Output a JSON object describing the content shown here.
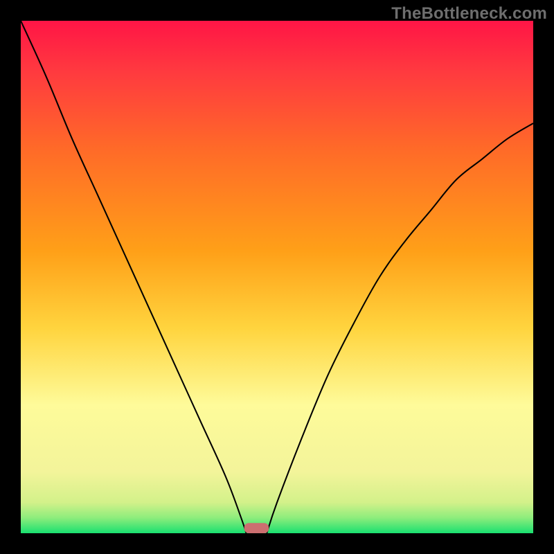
{
  "watermark": "TheBottleneck.com",
  "chart_data": {
    "type": "line",
    "title": "",
    "xlabel": "",
    "ylabel": "",
    "xlim": [
      0,
      100
    ],
    "ylim": [
      0,
      100
    ],
    "grid": false,
    "background_gradient_stops": [
      {
        "pos": 0.0,
        "color": "#19e070"
      },
      {
        "pos": 0.03,
        "color": "#8ded7c"
      },
      {
        "pos": 0.06,
        "color": "#d3f18a"
      },
      {
        "pos": 0.12,
        "color": "#f3f49a"
      },
      {
        "pos": 0.25,
        "color": "#fefb9a"
      },
      {
        "pos": 0.4,
        "color": "#ffd43e"
      },
      {
        "pos": 0.55,
        "color": "#ffa018"
      },
      {
        "pos": 0.75,
        "color": "#ff6a28"
      },
      {
        "pos": 0.9,
        "color": "#ff3a3f"
      },
      {
        "pos": 1.0,
        "color": "#ff1546"
      }
    ],
    "curve_left": {
      "x": [
        0,
        5,
        10,
        15,
        20,
        25,
        30,
        35,
        40,
        43,
        44
      ],
      "y": [
        100,
        89,
        77,
        66,
        55,
        44,
        33,
        22,
        11,
        3,
        0
      ]
    },
    "curve_right": {
      "x": [
        48,
        50,
        55,
        60,
        65,
        70,
        75,
        80,
        85,
        90,
        95,
        100
      ],
      "y": [
        0,
        6,
        19,
        31,
        41,
        50,
        57,
        63,
        69,
        73,
        77,
        80
      ]
    },
    "dip_marker": {
      "x_center": 46,
      "width": 4.8,
      "height": 2.0,
      "color": "#cc6f70"
    }
  }
}
